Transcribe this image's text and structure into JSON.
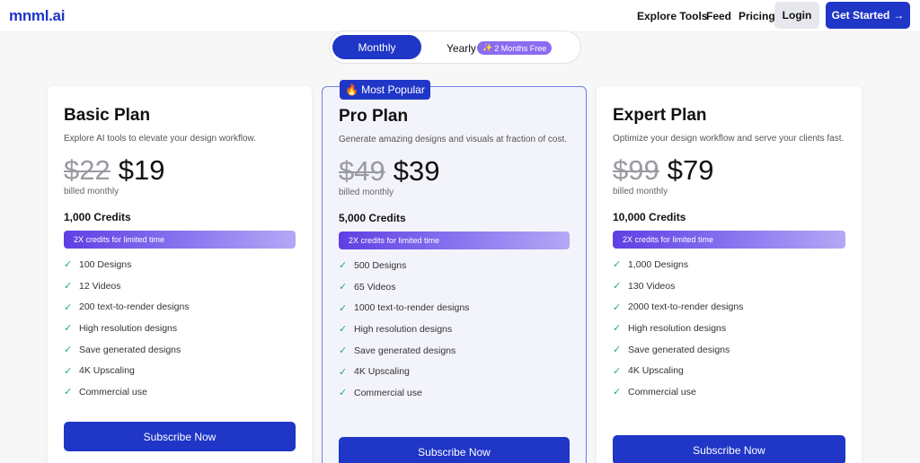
{
  "header": {
    "logo": "mnml.ai",
    "nav": [
      "Explore Tools",
      "Feed",
      "Pricing"
    ],
    "login": "Login",
    "get_started": "Get Started",
    "get_started_arrow": "→"
  },
  "billing_toggle": {
    "monthly": "Monthly",
    "yearly": "Yearly",
    "yearly_badge": "2 Months Free",
    "badge_icon": "✨",
    "selected": "Monthly"
  },
  "popular_badge": {
    "icon": "🔥",
    "label": "Most Popular"
  },
  "plans": [
    {
      "title": "Basic Plan",
      "description": "Explore AI tools to elevate your design workflow.",
      "old_price": "$22",
      "price": "$19",
      "billed": "billed monthly",
      "credits": "1,000 Credits",
      "promo": "2X credits for limited time",
      "features": [
        "100 Designs",
        "12 Videos",
        "200 text-to-render designs",
        "High resolution designs",
        "Save generated designs",
        "4K Upscaling",
        "Commercial use"
      ],
      "cta": "Subscribe Now"
    },
    {
      "title": "Pro Plan",
      "description": "Generate amazing designs and visuals at fraction of cost.",
      "old_price": "$49",
      "price": "$39",
      "billed": "billed monthly",
      "credits": "5,000 Credits",
      "promo": "2X credits for limited time",
      "features": [
        "500 Designs",
        "65 Videos",
        "1000 text-to-render designs",
        "High resolution designs",
        "Save generated designs",
        "4K Upscaling",
        "Commercial use"
      ],
      "cta": "Subscribe Now"
    },
    {
      "title": "Expert Plan",
      "description": "Optimize your design workflow and serve your clients fast.",
      "old_price": "$99",
      "price": "$79",
      "billed": "billed monthly",
      "credits": "10,000 Credits",
      "promo": "2X credits for limited time",
      "features": [
        "1,000 Designs",
        "130 Videos",
        "2000 text-to-render designs",
        "High resolution designs",
        "Save generated designs",
        "4K Upscaling",
        "Commercial use"
      ],
      "cta": "Subscribe Now"
    }
  ],
  "check_icon": "✓",
  "colors": {
    "brand": "#1f36c7",
    "check": "#2aa86a",
    "promo_start": "#5f3fe3",
    "promo_end": "#b5a8f5"
  }
}
